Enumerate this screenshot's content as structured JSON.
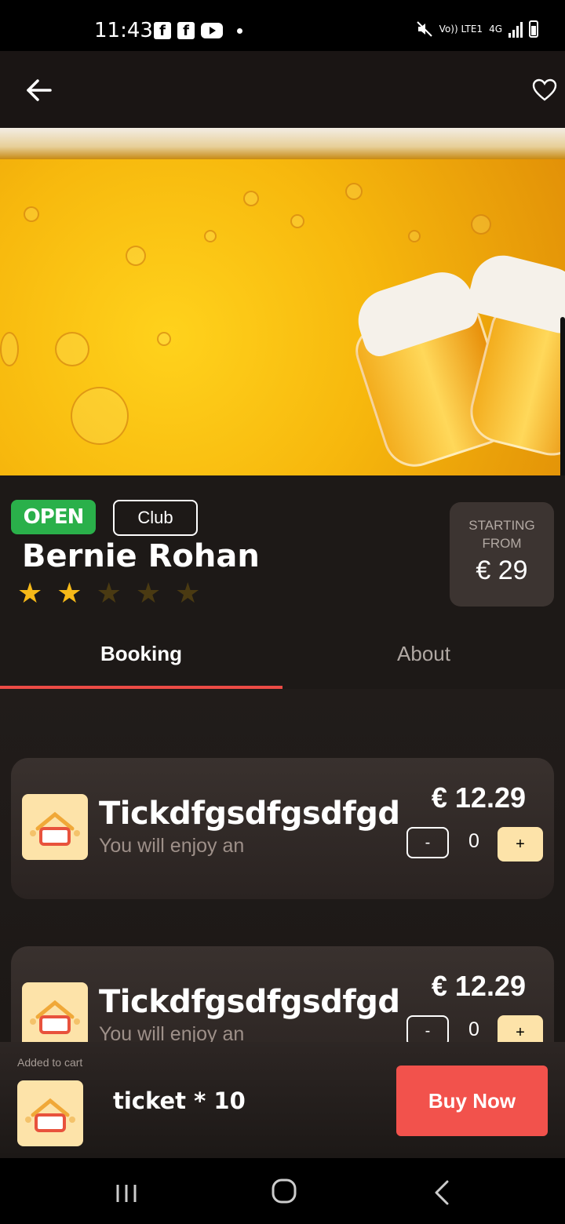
{
  "status_bar": {
    "time": "11:43",
    "app_icons": [
      "facebook-icon",
      "facebook-icon",
      "youtube-icon"
    ],
    "network": "4G",
    "volte": "Vo)) LTE1"
  },
  "app_bar": {
    "back_icon": "arrow-left-icon",
    "favorite_icon": "heart-icon"
  },
  "venue": {
    "status": "OPEN",
    "category": "Club",
    "name": "Bernie Rohan",
    "rating": 2,
    "rating_max": 5,
    "price_label": "STARTING FROM",
    "price": "€ 29"
  },
  "tabs": [
    {
      "label": "Booking",
      "active": true
    },
    {
      "label": "About",
      "active": false
    }
  ],
  "tickets": [
    {
      "title": "Tickdfgsdfgsdfgd",
      "description": "You will enjoy an",
      "price": "€ 12.29",
      "quantity": "0",
      "minus": "-",
      "plus": "+"
    },
    {
      "title": "Tickdfgsdfgsdfgd",
      "description": "You will enjoy an",
      "price": "€ 12.29",
      "quantity": "0",
      "minus": "-",
      "plus": "+"
    }
  ],
  "cart": {
    "label": "Added to cart",
    "summary": "ticket * 10",
    "button": "Buy Now"
  },
  "colors": {
    "accent": "#f2524c",
    "open_badge": "#2ab04a",
    "star": "#f6b918",
    "ticket_icon_bg": "#fde3a9"
  }
}
